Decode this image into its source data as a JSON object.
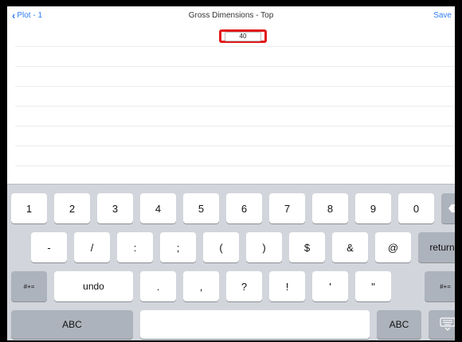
{
  "nav": {
    "back_label": "Plot - 1",
    "title": "Gross Dimensions - Top",
    "save_label": "Save"
  },
  "field": {
    "value": "40"
  },
  "keyboard": {
    "row1": [
      "1",
      "2",
      "3",
      "4",
      "5",
      "6",
      "7",
      "8",
      "9",
      "0"
    ],
    "row2": [
      "-",
      "/",
      ":",
      ";",
      "(",
      ")",
      "$",
      "&",
      "@"
    ],
    "return_label": "return",
    "shift_label": "#+=",
    "undo_label": "undo",
    "row3": [
      ".",
      ",",
      "?",
      "!",
      "'",
      "\""
    ],
    "abc_label": "ABC",
    "delete_icon": "backspace-icon",
    "hide_keyboard_icon": "keyboard-dismiss-icon"
  },
  "colors": {
    "accent": "#2f7cf6",
    "highlight": "#e21a1a",
    "keyboard_bg": "#d2d5db",
    "dark_key": "#adb3bc"
  }
}
